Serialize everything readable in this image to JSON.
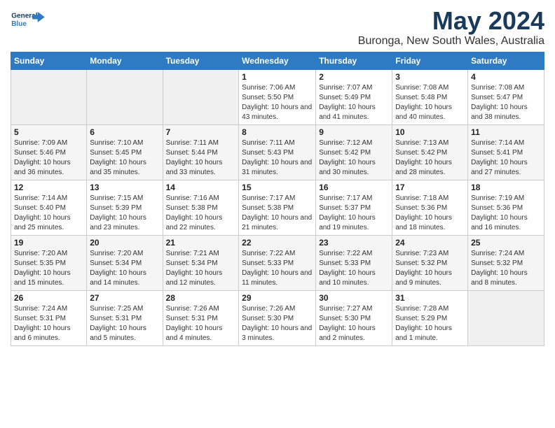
{
  "logo": {
    "line1": "General",
    "line2": "Blue"
  },
  "title": "May 2024",
  "subtitle": "Buronga, New South Wales, Australia",
  "days_of_week": [
    "Sunday",
    "Monday",
    "Tuesday",
    "Wednesday",
    "Thursday",
    "Friday",
    "Saturday"
  ],
  "weeks": [
    [
      {
        "day": "",
        "info": ""
      },
      {
        "day": "",
        "info": ""
      },
      {
        "day": "",
        "info": ""
      },
      {
        "day": "1",
        "info": "Sunrise: 7:06 AM\nSunset: 5:50 PM\nDaylight: 10 hours\nand 43 minutes."
      },
      {
        "day": "2",
        "info": "Sunrise: 7:07 AM\nSunset: 5:49 PM\nDaylight: 10 hours\nand 41 minutes."
      },
      {
        "day": "3",
        "info": "Sunrise: 7:08 AM\nSunset: 5:48 PM\nDaylight: 10 hours\nand 40 minutes."
      },
      {
        "day": "4",
        "info": "Sunrise: 7:08 AM\nSunset: 5:47 PM\nDaylight: 10 hours\nand 38 minutes."
      }
    ],
    [
      {
        "day": "5",
        "info": "Sunrise: 7:09 AM\nSunset: 5:46 PM\nDaylight: 10 hours\nand 36 minutes."
      },
      {
        "day": "6",
        "info": "Sunrise: 7:10 AM\nSunset: 5:45 PM\nDaylight: 10 hours\nand 35 minutes."
      },
      {
        "day": "7",
        "info": "Sunrise: 7:11 AM\nSunset: 5:44 PM\nDaylight: 10 hours\nand 33 minutes."
      },
      {
        "day": "8",
        "info": "Sunrise: 7:11 AM\nSunset: 5:43 PM\nDaylight: 10 hours\nand 31 minutes."
      },
      {
        "day": "9",
        "info": "Sunrise: 7:12 AM\nSunset: 5:42 PM\nDaylight: 10 hours\nand 30 minutes."
      },
      {
        "day": "10",
        "info": "Sunrise: 7:13 AM\nSunset: 5:42 PM\nDaylight: 10 hours\nand 28 minutes."
      },
      {
        "day": "11",
        "info": "Sunrise: 7:14 AM\nSunset: 5:41 PM\nDaylight: 10 hours\nand 27 minutes."
      }
    ],
    [
      {
        "day": "12",
        "info": "Sunrise: 7:14 AM\nSunset: 5:40 PM\nDaylight: 10 hours\nand 25 minutes."
      },
      {
        "day": "13",
        "info": "Sunrise: 7:15 AM\nSunset: 5:39 PM\nDaylight: 10 hours\nand 23 minutes."
      },
      {
        "day": "14",
        "info": "Sunrise: 7:16 AM\nSunset: 5:38 PM\nDaylight: 10 hours\nand 22 minutes."
      },
      {
        "day": "15",
        "info": "Sunrise: 7:17 AM\nSunset: 5:38 PM\nDaylight: 10 hours\nand 21 minutes."
      },
      {
        "day": "16",
        "info": "Sunrise: 7:17 AM\nSunset: 5:37 PM\nDaylight: 10 hours\nand 19 minutes."
      },
      {
        "day": "17",
        "info": "Sunrise: 7:18 AM\nSunset: 5:36 PM\nDaylight: 10 hours\nand 18 minutes."
      },
      {
        "day": "18",
        "info": "Sunrise: 7:19 AM\nSunset: 5:36 PM\nDaylight: 10 hours\nand 16 minutes."
      }
    ],
    [
      {
        "day": "19",
        "info": "Sunrise: 7:20 AM\nSunset: 5:35 PM\nDaylight: 10 hours\nand 15 minutes."
      },
      {
        "day": "20",
        "info": "Sunrise: 7:20 AM\nSunset: 5:34 PM\nDaylight: 10 hours\nand 14 minutes."
      },
      {
        "day": "21",
        "info": "Sunrise: 7:21 AM\nSunset: 5:34 PM\nDaylight: 10 hours\nand 12 minutes."
      },
      {
        "day": "22",
        "info": "Sunrise: 7:22 AM\nSunset: 5:33 PM\nDaylight: 10 hours\nand 11 minutes."
      },
      {
        "day": "23",
        "info": "Sunrise: 7:22 AM\nSunset: 5:33 PM\nDaylight: 10 hours\nand 10 minutes."
      },
      {
        "day": "24",
        "info": "Sunrise: 7:23 AM\nSunset: 5:32 PM\nDaylight: 10 hours\nand 9 minutes."
      },
      {
        "day": "25",
        "info": "Sunrise: 7:24 AM\nSunset: 5:32 PM\nDaylight: 10 hours\nand 8 minutes."
      }
    ],
    [
      {
        "day": "26",
        "info": "Sunrise: 7:24 AM\nSunset: 5:31 PM\nDaylight: 10 hours\nand 6 minutes."
      },
      {
        "day": "27",
        "info": "Sunrise: 7:25 AM\nSunset: 5:31 PM\nDaylight: 10 hours\nand 5 minutes."
      },
      {
        "day": "28",
        "info": "Sunrise: 7:26 AM\nSunset: 5:31 PM\nDaylight: 10 hours\nand 4 minutes."
      },
      {
        "day": "29",
        "info": "Sunrise: 7:26 AM\nSunset: 5:30 PM\nDaylight: 10 hours\nand 3 minutes."
      },
      {
        "day": "30",
        "info": "Sunrise: 7:27 AM\nSunset: 5:30 PM\nDaylight: 10 hours\nand 2 minutes."
      },
      {
        "day": "31",
        "info": "Sunrise: 7:28 AM\nSunset: 5:29 PM\nDaylight: 10 hours\nand 1 minute."
      },
      {
        "day": "",
        "info": ""
      }
    ]
  ]
}
